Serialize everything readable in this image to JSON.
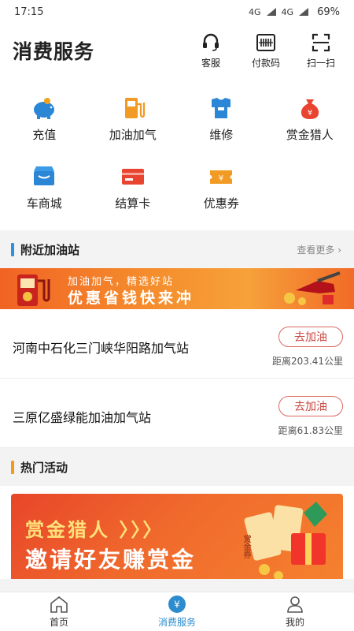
{
  "status_bar": {
    "time": "17:15",
    "battery": "69%",
    "network_a": "4G",
    "network_b": "4G"
  },
  "header": {
    "title": "消费服务",
    "actions": [
      {
        "label": "客服",
        "icon": "headset-icon"
      },
      {
        "label": "付款码",
        "icon": "barcode-icon"
      },
      {
        "label": "扫一扫",
        "icon": "scan-icon"
      }
    ]
  },
  "services": [
    {
      "label": "充值",
      "icon": "piggy-bank-icon"
    },
    {
      "label": "加油加气",
      "icon": "fuel-pump-icon"
    },
    {
      "label": "维修",
      "icon": "shirt-repair-icon"
    },
    {
      "label": "赏金猎人",
      "icon": "money-bag-icon"
    },
    {
      "label": "车商城",
      "icon": "store-icon"
    },
    {
      "label": "结算卡",
      "icon": "card-icon"
    },
    {
      "label": "优惠券",
      "icon": "coupon-icon"
    }
  ],
  "nearby": {
    "title": "附近加油站",
    "more": "查看更多 ›",
    "banner": {
      "line1": "加油加气，精选好站",
      "line2": "优惠省钱快来冲"
    },
    "stations": [
      {
        "name": "河南中石化三门峡华阳路加气站",
        "button": "去加油",
        "distance": "距离203.41公里"
      },
      {
        "name": "三原亿盛绿能加油加气站",
        "button": "去加油",
        "distance": "距离61.83公里"
      }
    ]
  },
  "hot": {
    "title": "热门活动",
    "banner": {
      "line1": "赏金猎人 〉〉〉",
      "line2": "邀请好友赚赏金",
      "coupon_text": "赏金券"
    }
  },
  "tabbar": [
    {
      "label": "首页",
      "active": false
    },
    {
      "label": "消费服务",
      "active": true
    },
    {
      "label": "我的",
      "active": false
    }
  ],
  "colors": {
    "accent_blue": "#2c8ccd",
    "accent_orange": "#f16324",
    "button_red": "#c9463f"
  }
}
